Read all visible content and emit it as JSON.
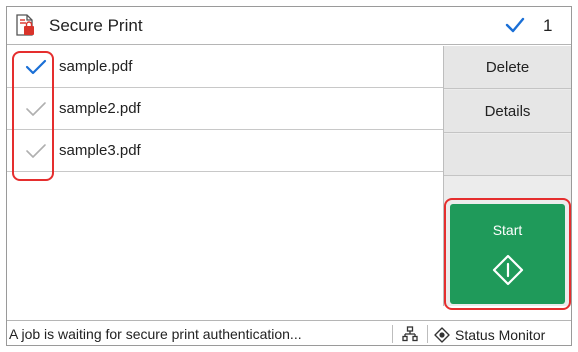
{
  "header": {
    "title": "Secure Print",
    "selected_count": "1",
    "app_icon": "secure-print-doc-icon"
  },
  "files": [
    {
      "name": "sample.pdf",
      "checked": true
    },
    {
      "name": "sample2.pdf",
      "checked": false
    },
    {
      "name": "sample3.pdf",
      "checked": false
    }
  ],
  "actions": {
    "delete_label": "Delete",
    "details_label": "Details",
    "start_label": "Start"
  },
  "status_bar": {
    "message": "A job is waiting for secure print authentication...",
    "network_icon": "network-icon",
    "status_monitor_label": "Status Monitor"
  },
  "colors": {
    "start_green": "#1f9a5a",
    "check_blue": "#1a6fd6",
    "check_gray": "#b0b0b0",
    "highlight_red": "#e52e2e",
    "doc_icon_red": "#d9342b"
  }
}
